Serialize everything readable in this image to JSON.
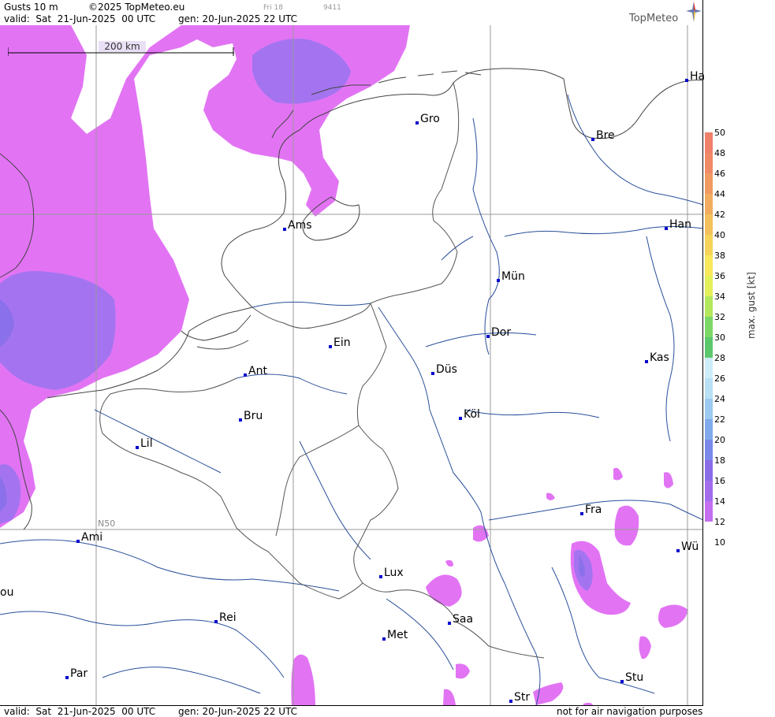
{
  "header": {
    "product": "Gusts 10 m",
    "copyright": "©2025 TopMeteo.eu",
    "frame_small": "Fri 18",
    "frame_code": "9411",
    "valid": "valid:  Sat  21-Jun-2025  00 UTC",
    "gen": "gen: 20-Jun-2025 22 UTC"
  },
  "logo": {
    "text": "TopMeteo",
    "icon": "star-logo-icon"
  },
  "scale": {
    "label": "200 km"
  },
  "grid_label": "N50",
  "cities": [
    {
      "name": "Ha",
      "icon": "city-marker-icon"
    },
    {
      "name": "Gro"
    },
    {
      "name": "Bre"
    },
    {
      "name": "Ams"
    },
    {
      "name": "Han"
    },
    {
      "name": "Mün"
    },
    {
      "name": "Ein"
    },
    {
      "name": "Dor"
    },
    {
      "name": "Ant"
    },
    {
      "name": "Düs"
    },
    {
      "name": "Kas"
    },
    {
      "name": "Köl"
    },
    {
      "name": "Bru"
    },
    {
      "name": "Lil"
    },
    {
      "name": "Fra"
    },
    {
      "name": "Ami"
    },
    {
      "name": "Wü"
    },
    {
      "name": "Lux"
    },
    {
      "name": "ou"
    },
    {
      "name": "Rei"
    },
    {
      "name": "Saa"
    },
    {
      "name": "Met"
    },
    {
      "name": "Par"
    },
    {
      "name": "Stu"
    },
    {
      "name": "Str"
    }
  ],
  "legend": {
    "title": "max. gust [kt]",
    "ticks": [
      "50",
      "48",
      "46",
      "44",
      "42",
      "40",
      "38",
      "36",
      "34",
      "32",
      "30",
      "28",
      "26",
      "24",
      "22",
      "20",
      "18",
      "16",
      "14",
      "12",
      "10"
    ],
    "colors": {
      "50": "#f0806a",
      "48": "#f08a66",
      "46": "#f09a62",
      "44": "#f2ac60",
      "42": "#f4c05c",
      "40": "#f6d45a",
      "38": "#f8e85a",
      "36": "#e4f05a",
      "34": "#b4e85c",
      "32": "#7cd866",
      "30": "#5cc86c",
      "28": "#cdeef8",
      "26": "#b8e0f4",
      "24": "#9ccaf0",
      "22": "#80aaec",
      "20": "#7a88ea",
      "18": "#8a6ce8",
      "16": "#a26cec",
      "14": "#c46ef0",
      "12": "#e274f4"
    }
  },
  "footer": {
    "valid": "valid:  Sat  21-Jun-2025  00 UTC",
    "gen": "gen: 20-Jun-2025 22 UTC",
    "note": "not for air navigation purposes"
  }
}
